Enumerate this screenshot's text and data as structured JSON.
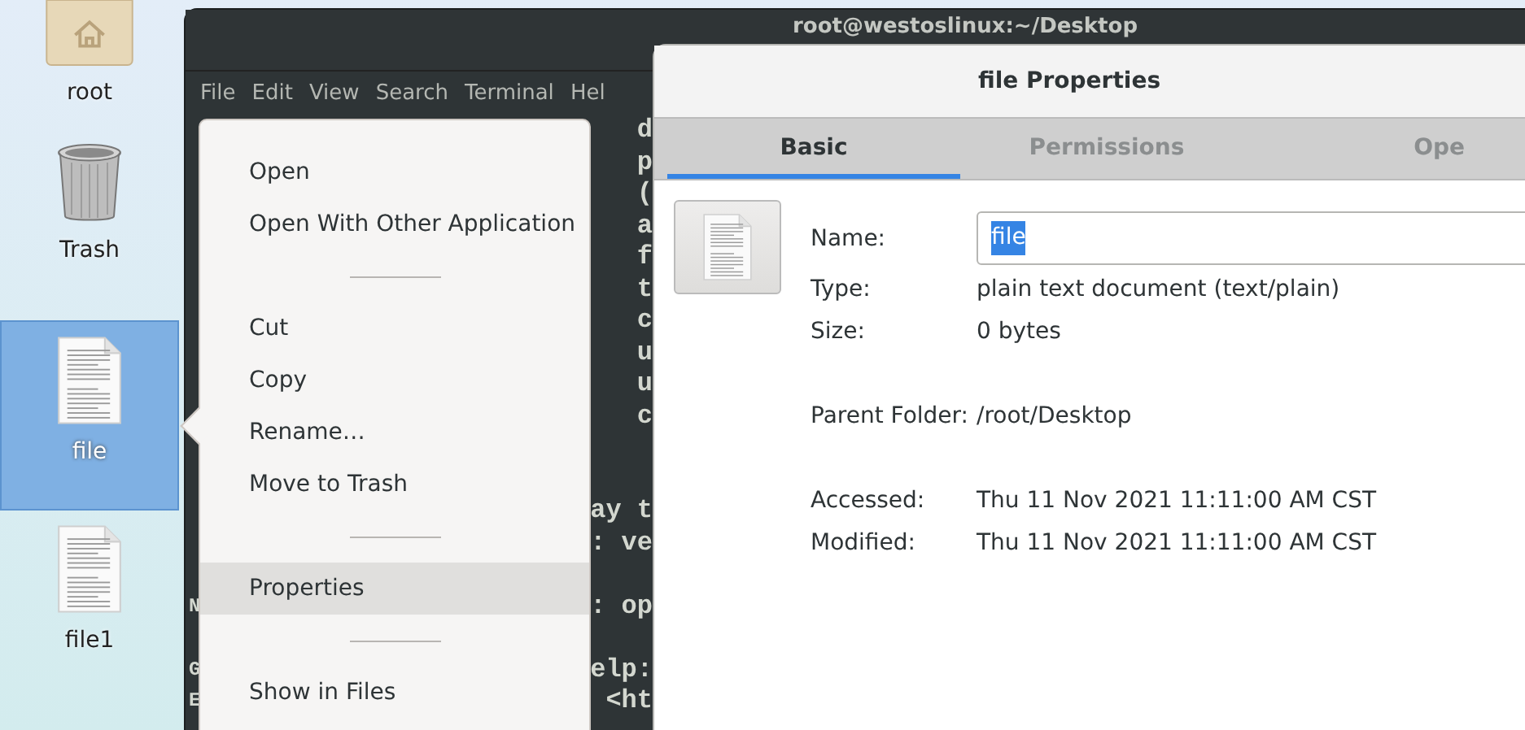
{
  "desktop_icons": [
    {
      "label": "root",
      "kind": "folder",
      "selected": false
    },
    {
      "label": "Trash",
      "kind": "trash",
      "selected": false
    },
    {
      "label": "file",
      "kind": "document",
      "selected": true
    },
    {
      "label": "file1",
      "kind": "document",
      "selected": false
    }
  ],
  "terminal": {
    "title": "root@westoslinux:~/Desktop",
    "menu": [
      "File",
      "Edit",
      "View",
      "Search",
      "Terminal",
      "Hel"
    ],
    "blocks": [
      [
        {
          "right": "d"
        },
        {
          "right": "p"
        },
        {
          "right": "("
        },
        {
          "right": "a"
        },
        {
          "right": "f"
        },
        {
          "right": "t"
        },
        {
          "right": "c"
        },
        {
          "right": "u"
        },
        {
          "right": "u"
        },
        {
          "right": "c"
        }
      ],
      [
        {
          "right": "ay t"
        },
        {
          "right": ": ve"
        }
      ],
      [
        {
          "left": "N",
          "right": ": op"
        }
      ],
      [
        {
          "left": "G",
          "right": "elp:"
        },
        {
          "left": "E",
          "right": "<ht"
        }
      ]
    ]
  },
  "context_menu": {
    "items": [
      {
        "kind": "item",
        "label": "Open",
        "selected": false
      },
      {
        "kind": "item",
        "label": "Open With Other Application",
        "selected": false
      },
      {
        "kind": "separator"
      },
      {
        "kind": "item",
        "label": "Cut",
        "selected": false
      },
      {
        "kind": "item",
        "label": "Copy",
        "selected": false
      },
      {
        "kind": "item",
        "label": "Rename…",
        "selected": false
      },
      {
        "kind": "item",
        "label": "Move to Trash",
        "selected": false
      },
      {
        "kind": "separator"
      },
      {
        "kind": "item",
        "label": "Properties",
        "selected": true
      },
      {
        "kind": "separator"
      },
      {
        "kind": "item",
        "label": "Show in Files",
        "selected": false
      }
    ]
  },
  "dialog": {
    "title": "file Properties",
    "tabs": [
      {
        "label": "Basic",
        "selected": true
      },
      {
        "label": "Permissions",
        "selected": false
      },
      {
        "label": "Ope",
        "selected": false
      }
    ],
    "name": {
      "label": "Name:",
      "value": "file",
      "text_selected": true
    },
    "groups": [
      [
        {
          "label": "Type:",
          "value": "plain text document (text/plain)"
        },
        {
          "label": "Size:",
          "value": "0 bytes"
        }
      ],
      [
        {
          "label": "Parent Folder:",
          "value": "/root/Desktop"
        }
      ],
      [
        {
          "label": "Accessed:",
          "value": "Thu 11 Nov 2021 11:11:00 AM CST"
        },
        {
          "label": "Modified:",
          "value": "Thu 11 Nov 2021 11:11:00 AM CST"
        }
      ]
    ]
  }
}
